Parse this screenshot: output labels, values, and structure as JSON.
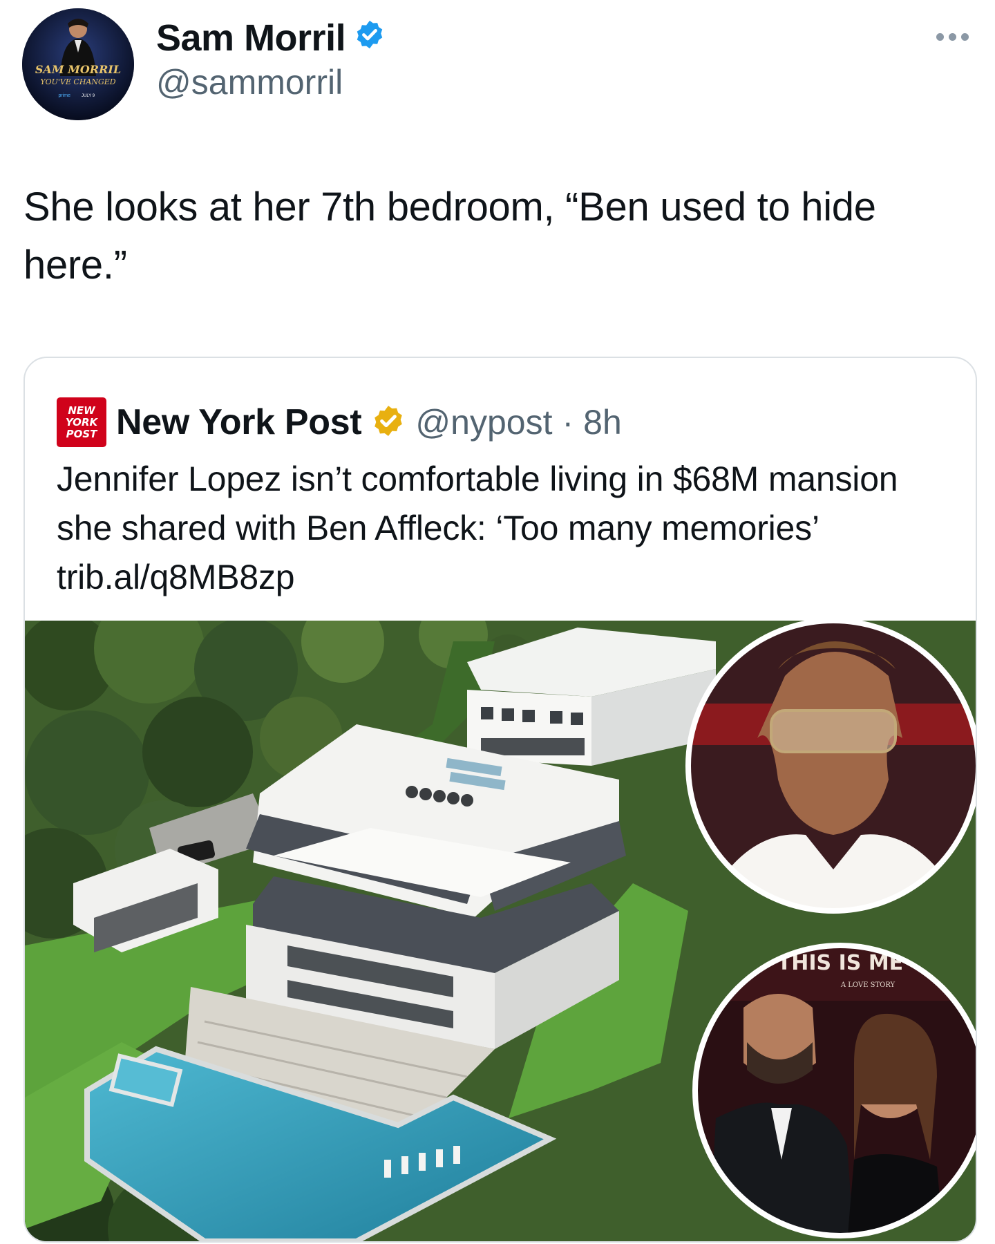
{
  "author": {
    "name": "Sam Morril",
    "handle": "@sammorril",
    "avatar_text": [
      "SAM MORRIL",
      "YOU'VE CHANGED",
      "prime",
      "JULY 9"
    ]
  },
  "tweet": {
    "text": "She looks at her 7th bedroom, “Ben used to hide here.”"
  },
  "quote": {
    "logo_text": [
      "NEW",
      "YORK",
      "POST"
    ],
    "name": "New York Post",
    "handle": "@nypost",
    "separator": "·",
    "time": "8h",
    "text": "Jennifer Lopez isn’t comfortable living in $68M mansion she shared with Ben Affleck: ‘Too many memories’ trib.al/q8MB8zp"
  },
  "media": {
    "backdrop_text": "THIS IS ME",
    "backdrop_subtext": "A LOVE STORY"
  },
  "icons": {
    "author_verified": "verified-badge-icon",
    "quote_verified": "gold-verified-badge-icon",
    "more": "more-options-icon"
  },
  "colors": {
    "verified_blue": "#1d9bf0",
    "verified_gold": "#e8b010",
    "nypost_red": "#d0021b",
    "text_primary": "#0f1419",
    "text_secondary": "#536471"
  }
}
